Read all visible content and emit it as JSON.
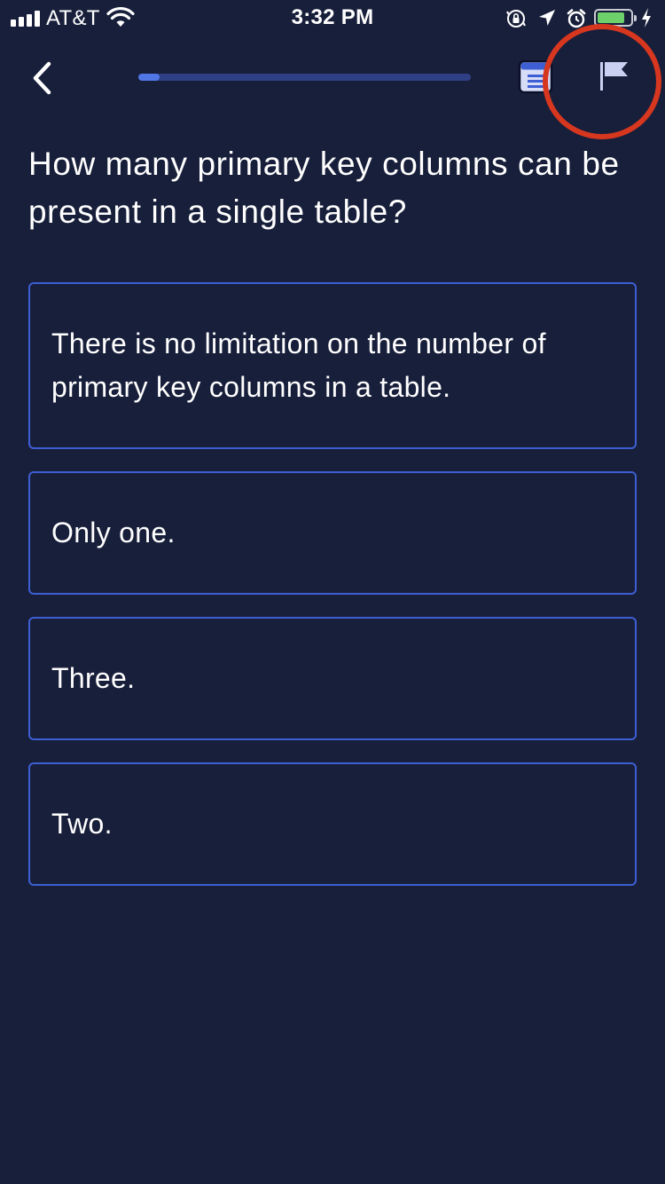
{
  "status_bar": {
    "carrier": "AT&T",
    "time": "3:32 PM",
    "icons": [
      "signal-icon",
      "wifi-icon",
      "orientation-lock-icon",
      "location-icon",
      "alarm-icon",
      "battery-icon",
      "charging-icon"
    ]
  },
  "nav": {
    "back_icon": "chevron-left-icon",
    "progress_fraction": 0.065,
    "notes_icon": "notes-icon",
    "flag_icon": "flag-icon"
  },
  "colors": {
    "background": "#181f3b",
    "accent": "#3d5fd3",
    "progress_fill": "#5176e6",
    "highlight": "#d8371f"
  },
  "question": {
    "text": "How many primary key columns can be present in a single table?"
  },
  "answers": [
    {
      "text": "There is no limitation on the number of primary key columns in a table."
    },
    {
      "text": "Only one."
    },
    {
      "text": "Three."
    },
    {
      "text": "Two."
    }
  ]
}
